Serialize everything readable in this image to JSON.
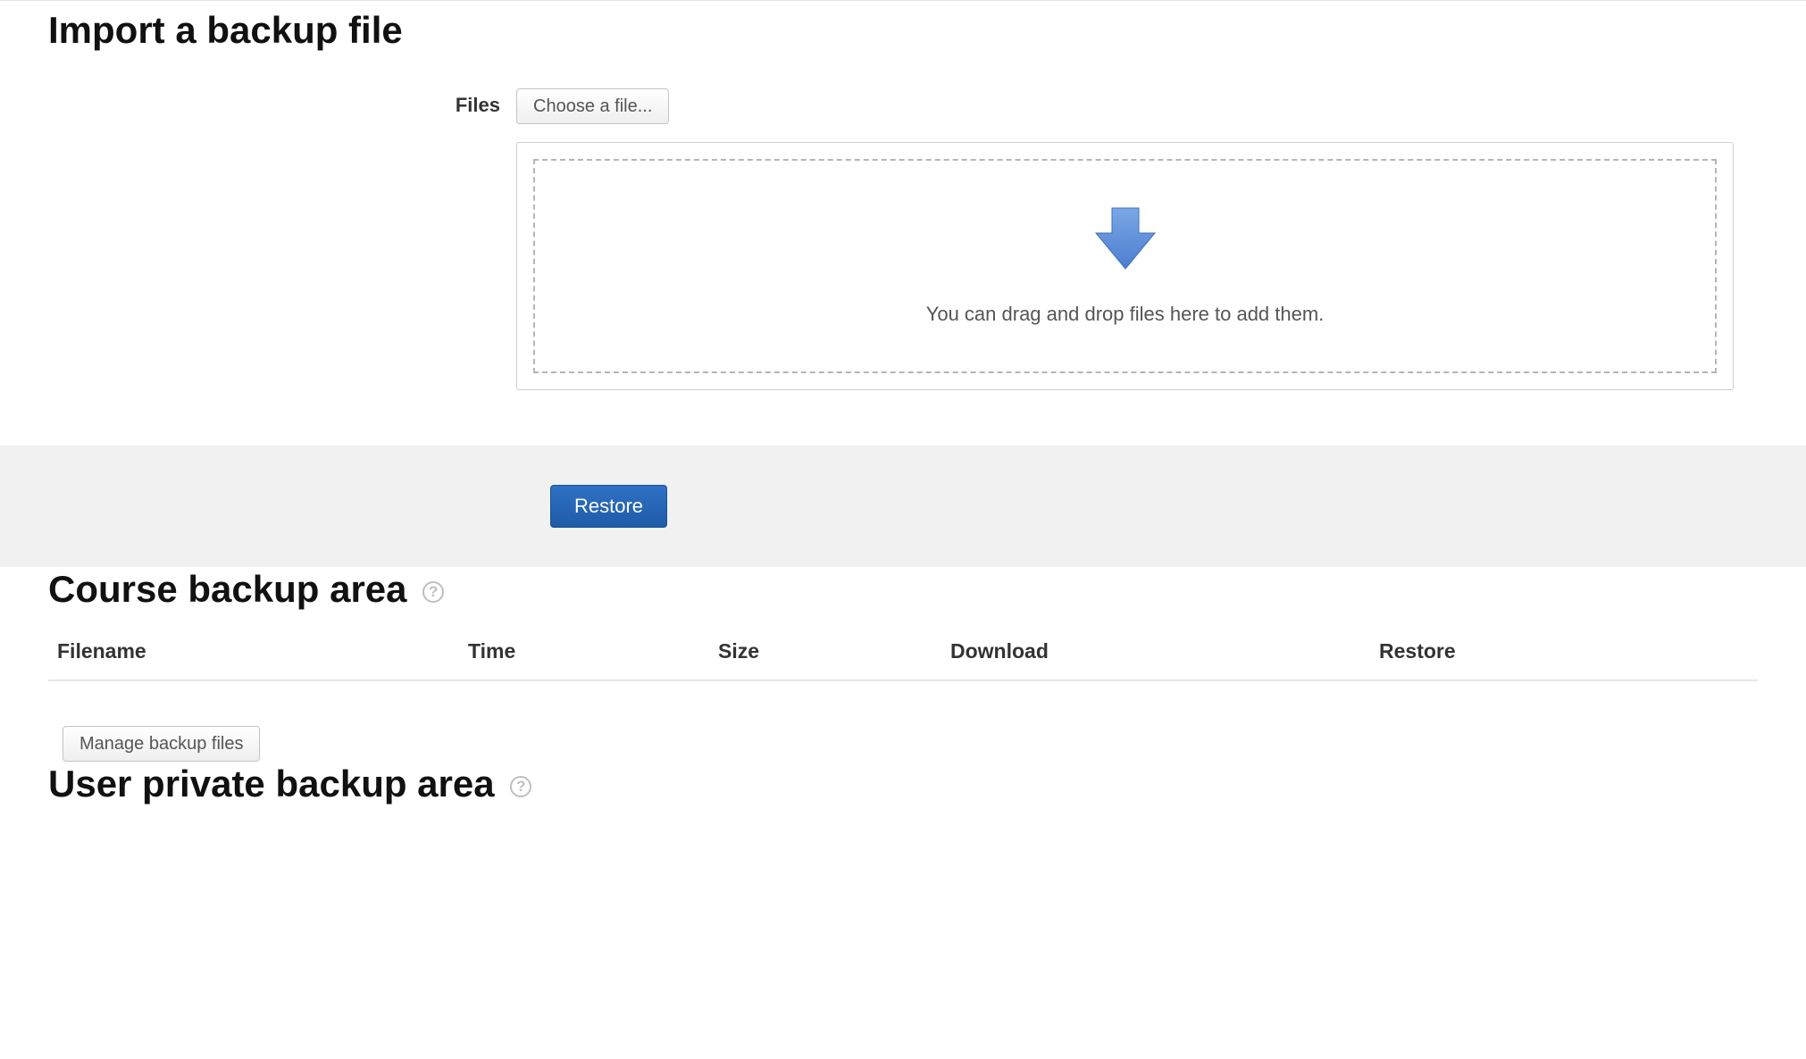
{
  "import": {
    "heading": "Import a backup file",
    "files_label": "Files",
    "choose_button": "Choose a file...",
    "dropzone_text": "You can drag and drop files here to add them.",
    "restore_button": "Restore"
  },
  "course_backup": {
    "heading": "Course backup area",
    "columns": {
      "filename": "Filename",
      "time": "Time",
      "size": "Size",
      "download": "Download",
      "restore": "Restore"
    },
    "rows": [],
    "manage_button": "Manage backup files"
  },
  "user_private": {
    "heading": "User private backup area"
  },
  "icons": {
    "help": "?"
  }
}
